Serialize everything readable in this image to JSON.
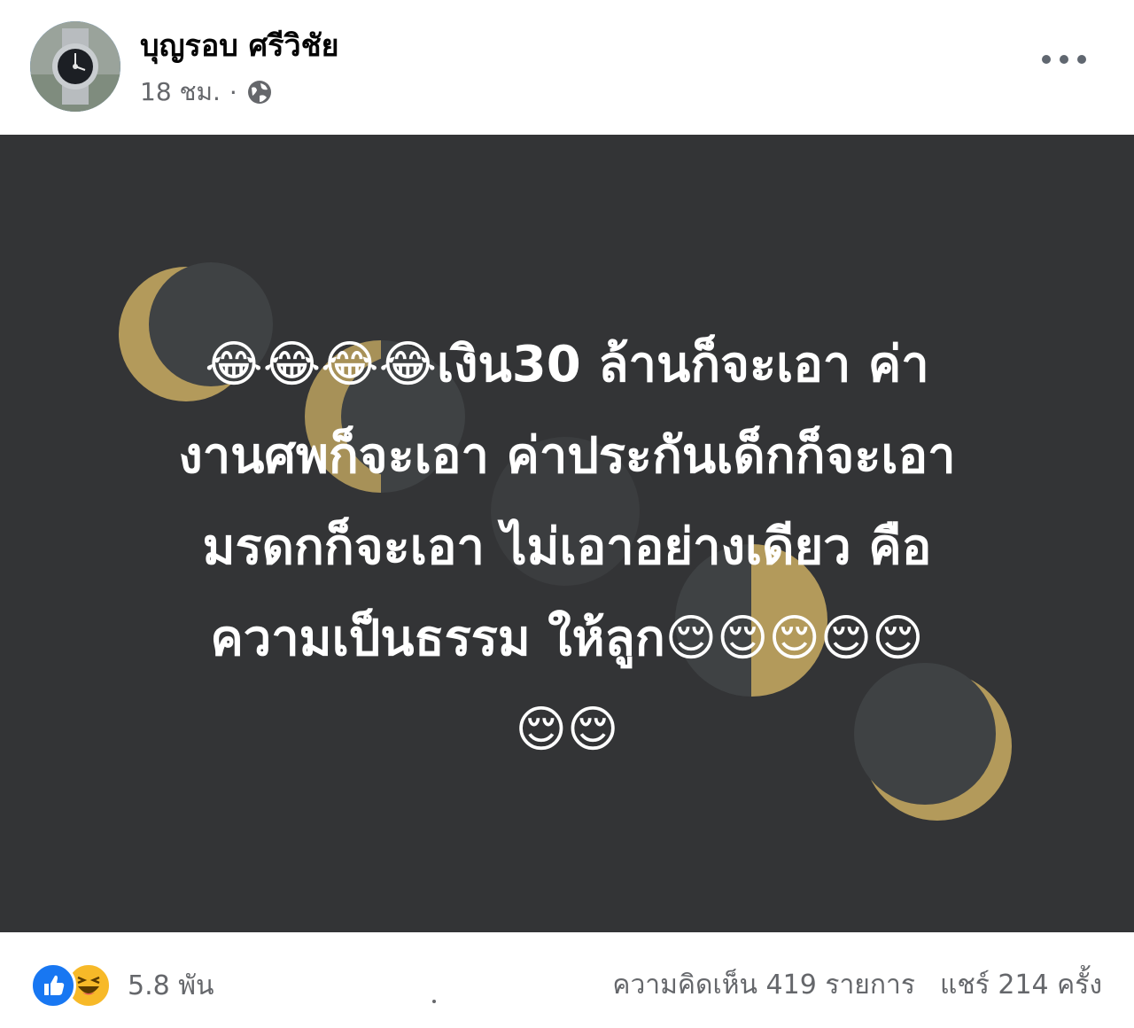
{
  "post": {
    "author": "บุญรอบ ศรีวิชัย",
    "time": "18 ชม.",
    "separator": "·",
    "privacy_icon": "globe-icon",
    "more_icon": "more-options-icon",
    "text": "😂😂😂😂เงิน30 ล้านก็จะเอา ค่างานศพก็จะเอา ค่าประกันเด็กก็จะเอา มรดกก็จะเอา ไม่เอาอย่างเดียว คือความเป็นธรรม ให้ลูก😌😌😌😌😌😌😌",
    "text_lines": [
      "😂😂😂😂เงิน30 ล้านก็จะเอา ค่า",
      "งานศพก็จะเอา ค่าประกันเด็กก็จะเอา",
      "มรดกก็จะเอา ไม่เอาอย่างเดียว คือ",
      "ความเป็นธรรม ให้ลูก😌😌😌😌😌",
      "😌😌"
    ],
    "background_color": "#333436",
    "accent_color": "#b39a5b",
    "text_color": "#ffffff"
  },
  "footer": {
    "reaction_icons": [
      "like-icon",
      "haha-icon"
    ],
    "reaction_count": "5.8 พัน",
    "comments": "ความคิดเห็น 419 รายการ",
    "shares": "แชร์ 214 ครั้ง",
    "like_color": "#1877f2",
    "haha_color": "#f7b928"
  }
}
